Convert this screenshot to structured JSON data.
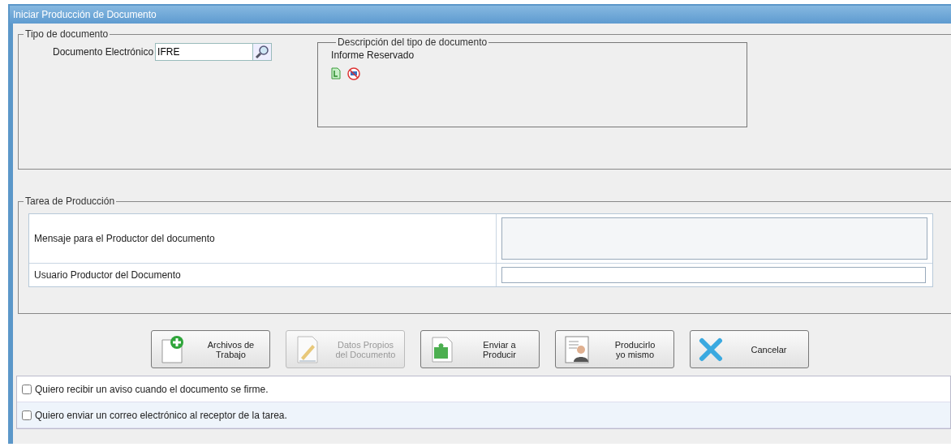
{
  "window": {
    "title": "Iniciar Producción de Documento"
  },
  "tipo_documento": {
    "legend": "Tipo de documento",
    "field_label": "Documento Electrónico",
    "field_value": "IFRE",
    "descripcion": {
      "legend": "Descripción del tipo de documento",
      "text": "Informe Reservado"
    }
  },
  "tarea": {
    "legend": "Tarea de Producción",
    "rows": [
      {
        "label": "Mensaje para el Productor del documento",
        "kind": "textarea"
      },
      {
        "label": "Usuario Productor del Documento",
        "kind": "input"
      }
    ]
  },
  "buttons": [
    {
      "label": "Archivos de\nTrabajo",
      "kind": "files",
      "disabled": false
    },
    {
      "label": "Datos Propios\ndel Documento",
      "kind": "data",
      "disabled": true
    },
    {
      "label": "Enviar a\nProducir",
      "kind": "send",
      "disabled": false
    },
    {
      "label": "Producirlo\nyo mismo",
      "kind": "self",
      "disabled": false
    },
    {
      "label": "Cancelar",
      "kind": "cancel",
      "disabled": false
    }
  ],
  "options": [
    {
      "label": "Quiero recibir un aviso cuando el documento se firme.",
      "checked": false
    },
    {
      "label": "Quiero enviar un correo electrónico al receptor de la tarea.",
      "checked": false
    }
  ]
}
